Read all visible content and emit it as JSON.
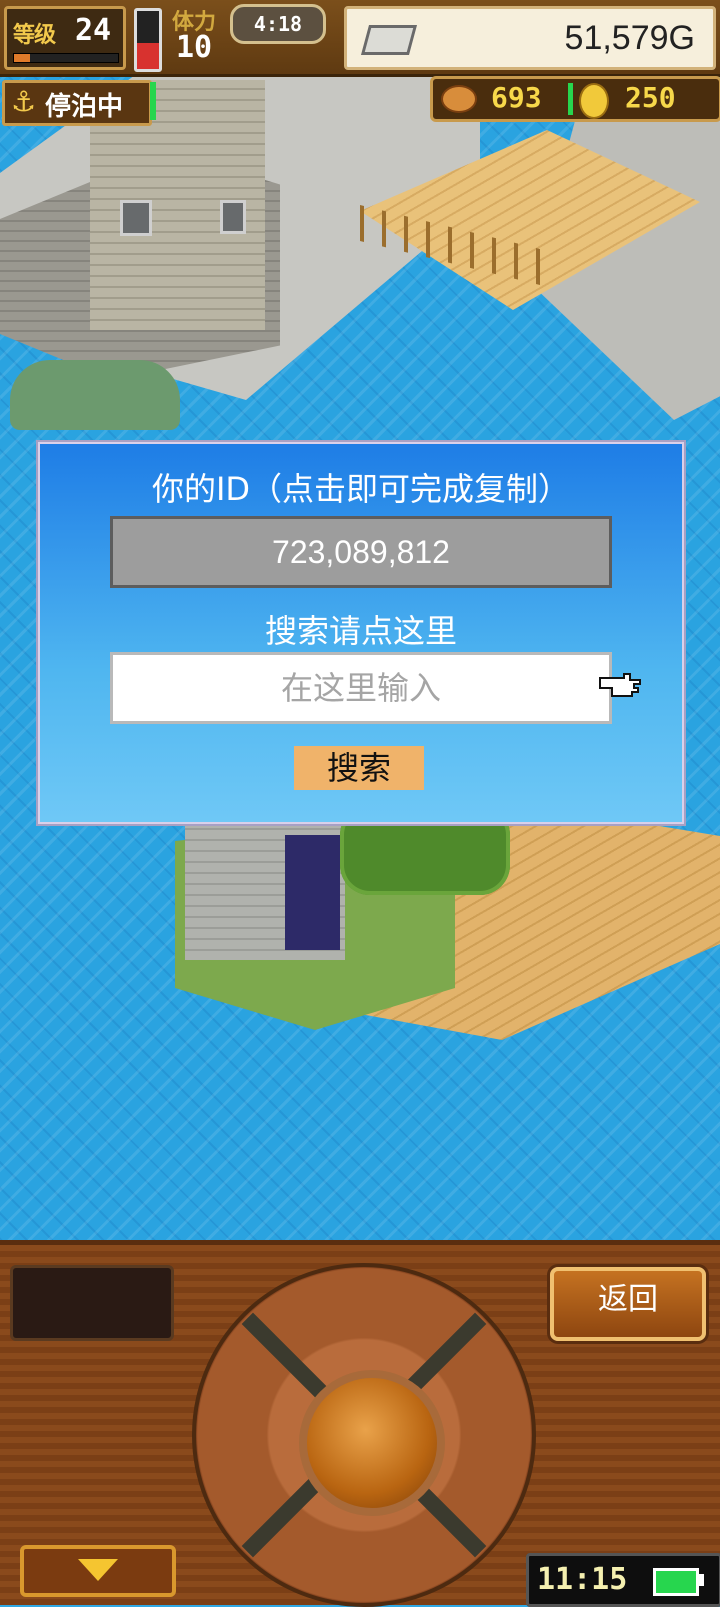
{
  "hud": {
    "level_label": "等级",
    "level_value": "24",
    "level_progress": 0.15,
    "hp_level": 0.45,
    "stamina_label": "体力",
    "stamina_value": "10",
    "clock": "4:18",
    "gold": "51,579G"
  },
  "status": {
    "docked_label": "停泊中"
  },
  "resources": {
    "food": "693",
    "coins": "250"
  },
  "dialog": {
    "id_title": "你的ID（点击即可完成复制）",
    "id_value": "723,089,812",
    "search_title": "搜索请点这里",
    "search_placeholder": "在这里输入",
    "search_button": "搜索"
  },
  "controller": {
    "back_label": "返回",
    "time": "11:15"
  },
  "colors": {
    "sea": "#2aa3e0",
    "dialog_top": "#1e7de6",
    "dialog_bottom": "#6fc8f6",
    "search_button": "#f0b36a",
    "wood": "#8a4a1c"
  }
}
